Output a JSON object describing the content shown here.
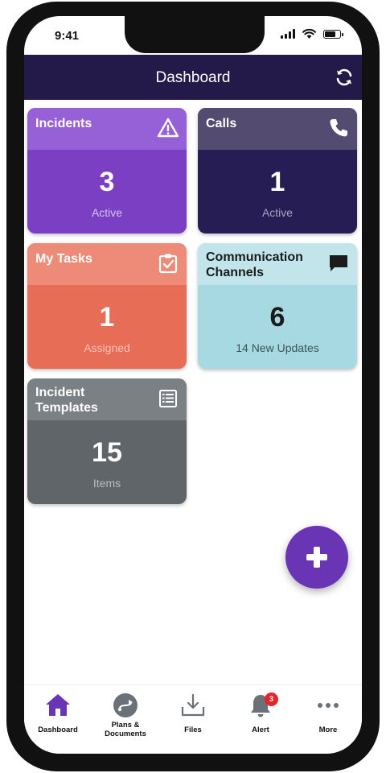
{
  "status_bar": {
    "time": "9:41"
  },
  "header": {
    "title": "Dashboard"
  },
  "cards": [
    {
      "title": "Incidents",
      "count": "3",
      "subtitle": "Active",
      "icon": "warning-icon"
    },
    {
      "title": "Calls",
      "count": "1",
      "subtitle": "Active",
      "icon": "phone-icon"
    },
    {
      "title": "My Tasks",
      "count": "1",
      "subtitle": "Assigned",
      "icon": "clipboard-check-icon"
    },
    {
      "title": "Communication Channels",
      "count": "6",
      "subtitle": "14 New Updates",
      "icon": "chat-bubble-icon"
    },
    {
      "title": "Incident Templates",
      "count": "15",
      "subtitle": "Items",
      "icon": "document-list-icon"
    }
  ],
  "tabbar": {
    "items": [
      {
        "label": "Dashboard",
        "icon": "home-icon",
        "active": true
      },
      {
        "label": "Plans & Documents",
        "icon": "route-icon"
      },
      {
        "label": "Files",
        "icon": "download-icon"
      },
      {
        "label": "Alert",
        "icon": "bell-icon",
        "badge": "3"
      },
      {
        "label": "More",
        "icon": "more-dots-icon"
      }
    ]
  },
  "colors": {
    "header": "#241a4a",
    "incidents": "#7b3fc4",
    "calls": "#261d55",
    "tasks": "#e86d57",
    "channels": "#a6d9e2",
    "templates": "#5f6569",
    "accent": "#6a35b5",
    "badge": "#e3262c"
  }
}
